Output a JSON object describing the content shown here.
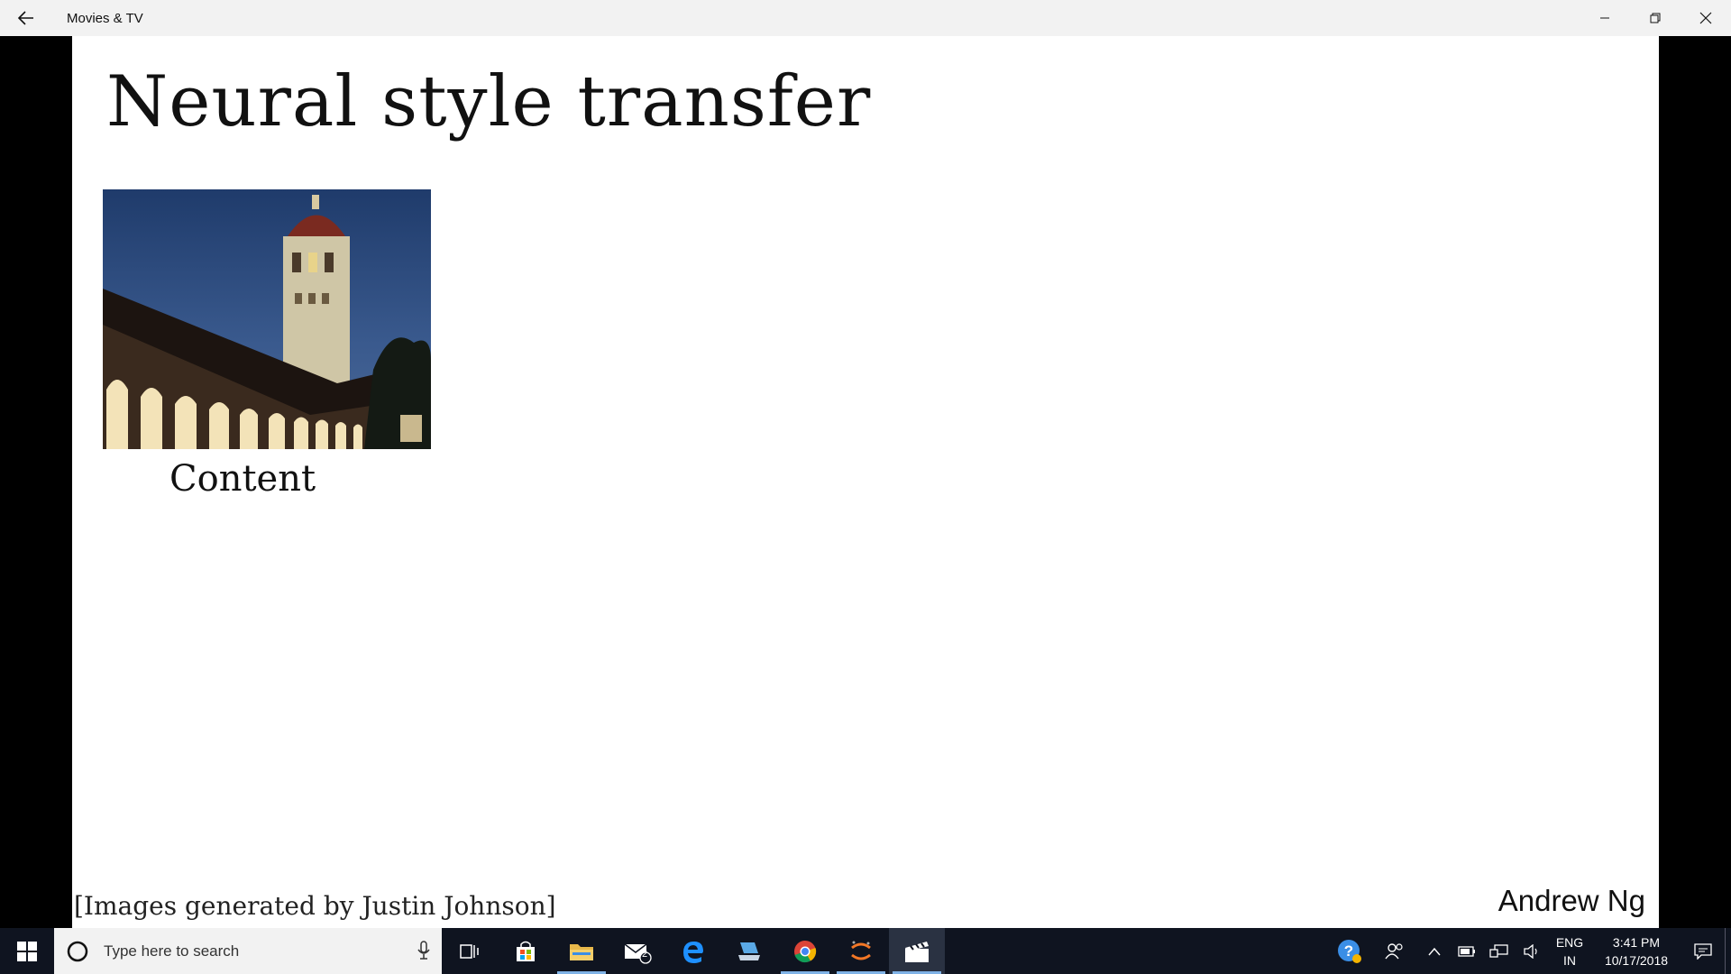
{
  "window": {
    "title": "Movies & TV",
    "back_icon": "back-arrow-icon",
    "controls": [
      "minimize-icon",
      "restore-icon",
      "close-icon"
    ]
  },
  "slide": {
    "title": "Neural style transfer",
    "content_label": "Content",
    "credit": "[Images generated by Justin Johnson]",
    "author": "Andrew Ng"
  },
  "taskbar": {
    "search_placeholder": "Type here to search",
    "mail_badge": "2",
    "apps": [
      "task-view-icon",
      "store-icon",
      "file-explorer-icon",
      "mail-icon",
      "edge-icon",
      "devices-icon",
      "chrome-icon",
      "jupyter-icon",
      "movies-tv-icon"
    ],
    "tray": {
      "language_line1": "ENG",
      "language_line2": "IN",
      "time": "3:41 PM",
      "date": "10/17/2018"
    }
  },
  "colors": {
    "taskbar_bg": "#0f1420",
    "titlebar_bg": "#f2f2f2",
    "accent": "#7fb2e6"
  }
}
